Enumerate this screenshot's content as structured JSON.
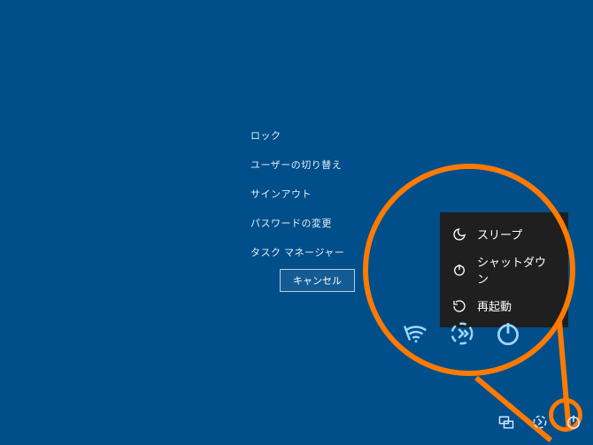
{
  "options": {
    "lock": "ロック",
    "switch_user": "ユーザーの切り替え",
    "sign_out": "サインアウト",
    "change_password": "パスワードの変更",
    "task_manager": "タスク マネージャー"
  },
  "cancel": "キャンセル",
  "power_menu": {
    "sleep": "スリープ",
    "shutdown": "シャットダウン",
    "restart": "再起動"
  },
  "icons": {
    "wifi": "wifi-icon",
    "ease_of_access": "ease-of-access-icon",
    "power": "power-icon",
    "network": "network-icon",
    "sleep": "sleep-icon",
    "shutdown": "power-icon",
    "restart": "restart-icon"
  },
  "colors": {
    "background": "#004e8a",
    "annotation": "#ff7a00",
    "panel": "#1f1f1f"
  }
}
